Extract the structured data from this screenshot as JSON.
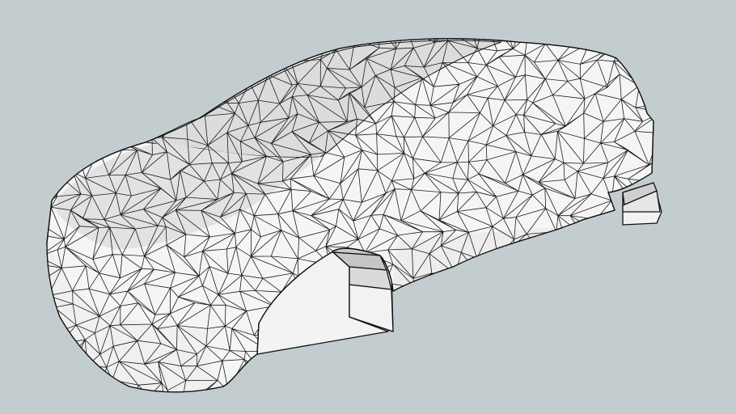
{
  "scene": {
    "subject": "",
    "background_color": "#c3cdd0",
    "surface_light": "#ffffff",
    "surface_mid": "#e4e4e4",
    "surface_dark": "#c9c9c9",
    "glass_color": "#dcdcdc",
    "edge_color": "#1a1a1a"
  }
}
